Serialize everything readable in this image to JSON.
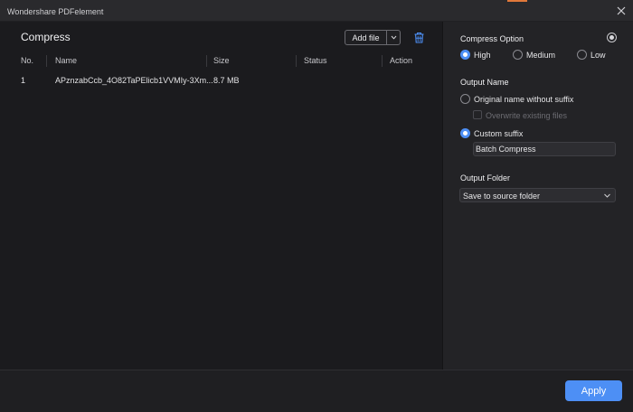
{
  "window": {
    "title": "Wondershare PDFelement"
  },
  "colors": {
    "accent": "#4d8ff5",
    "background": "#1b1b1e",
    "panel": "#232326",
    "top_strip": "#e0783a"
  },
  "compress": {
    "heading": "Compress",
    "add_file_label": "Add file",
    "icons": {
      "dropdown": "chevron-down-icon",
      "clear": "trash-icon",
      "close": "close-icon",
      "info": "info-icon"
    },
    "table": {
      "columns": [
        "No.",
        "Name",
        "Size",
        "Status",
        "Action"
      ],
      "rows": [
        {
          "no": "1",
          "name": "APznzabCcb_4O82TaPElicb1VVMIy-3Xm...",
          "size": "8.7 MB",
          "status": "",
          "action": ""
        }
      ]
    }
  },
  "options": {
    "compress_option_label": "Compress Option",
    "levels": [
      "High",
      "Medium",
      "Low"
    ],
    "selected_level": "High",
    "output_name_label": "Output Name",
    "original_name_label": "Original name without suffix",
    "overwrite_label": "Overwrite existing files",
    "custom_suffix_label": "Custom suffix",
    "custom_suffix_value": "Batch Compress",
    "output_folder_label": "Output Folder",
    "output_folder_value": "Save to source folder"
  },
  "footer": {
    "apply_label": "Apply"
  }
}
